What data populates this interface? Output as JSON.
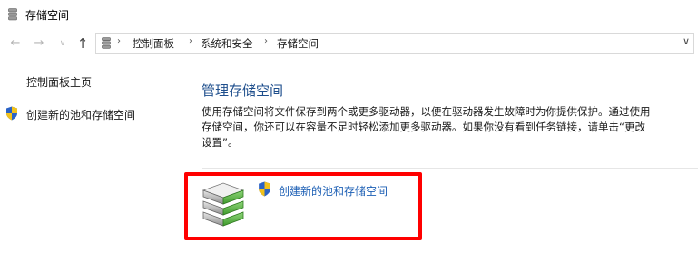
{
  "window": {
    "title": "存储空间"
  },
  "nav": {
    "back_icon": "arrow-left-icon",
    "forward_icon": "arrow-right-icon",
    "recent_icon": "chevron-down-icon",
    "up_icon": "arrow-up-icon"
  },
  "breadcrumb": {
    "items": [
      "控制面板",
      "系统和安全",
      "存储空间"
    ]
  },
  "left_pane": {
    "home_link": "控制面板主页",
    "create_link": "创建新的池和存储空间"
  },
  "main": {
    "title": "管理存储空间",
    "description": "使用存储空间将文件保存到两个或更多驱动器，以便在驱动器发生故障时为你提供保护。通过使用存储空间，你还可以在容量不足时轻松添加更多驱动器。如果你没有看到任务链接，请单击“更改设置”。",
    "action_link": "创建新的池和存储空间"
  },
  "colors": {
    "title_blue": "#1e4e8c",
    "link_blue": "#1e60b5",
    "highlight_red": "#ff0000"
  }
}
